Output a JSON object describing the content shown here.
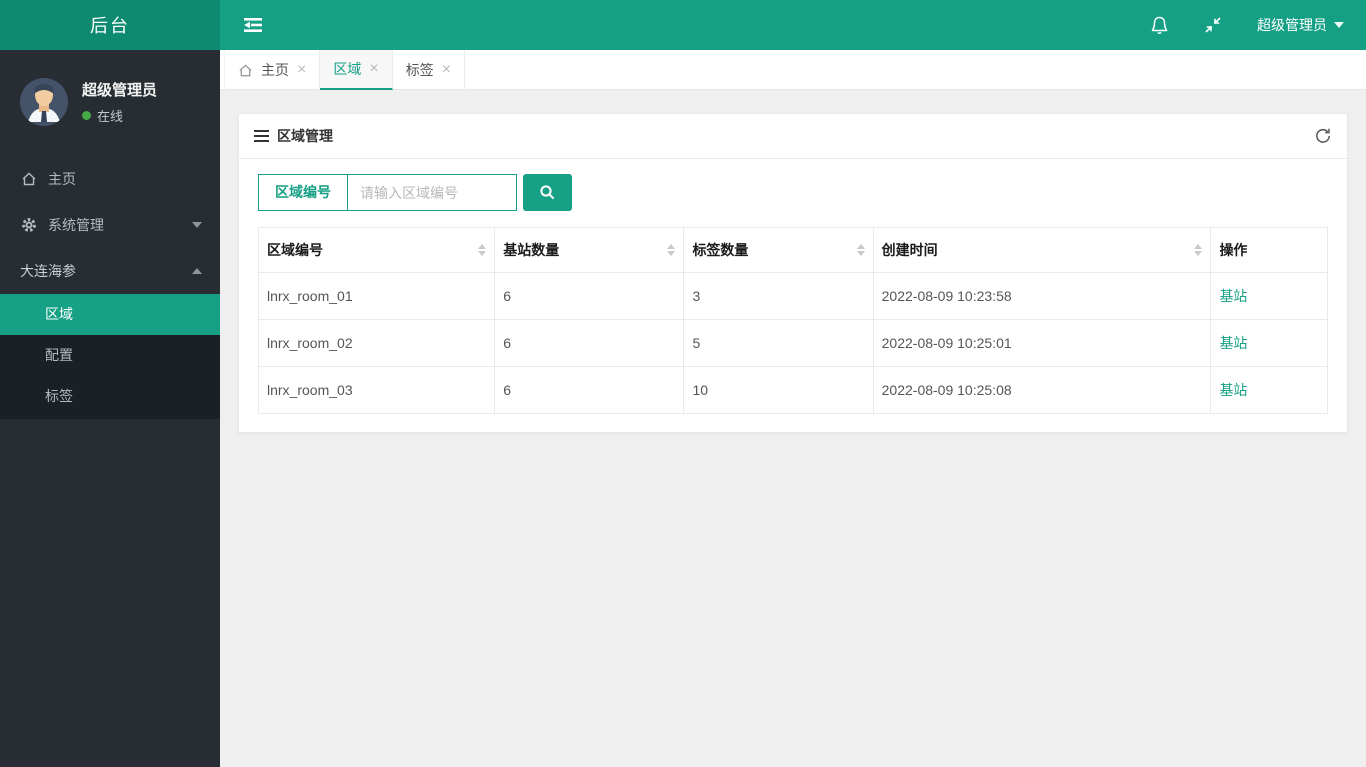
{
  "app": {
    "logo_text": "后台"
  },
  "header": {
    "user_name": "超级管理员"
  },
  "sidebar": {
    "user": {
      "name": "超级管理员",
      "status": "在线"
    },
    "menu": {
      "home": "主页",
      "system": "系统管理",
      "group": "大连海参",
      "sub": [
        "区域",
        "配置",
        "标签"
      ]
    }
  },
  "tabs": [
    {
      "label": "主页"
    },
    {
      "label": "区域"
    },
    {
      "label": "标签"
    }
  ],
  "icons": {
    "close": "×"
  },
  "panel": {
    "title": "区域管理",
    "search": {
      "label": "区域编号",
      "placeholder": "请输入区域编号"
    },
    "table": {
      "headers": [
        "区域编号",
        "基站数量",
        "标签数量",
        "创建时间",
        "操作"
      ],
      "rows": [
        {
          "id": "lnrx_room_01",
          "stations": "6",
          "tags": "3",
          "created": "2022-08-09 10:23:58",
          "action": "基站"
        },
        {
          "id": "lnrx_room_02",
          "stations": "6",
          "tags": "5",
          "created": "2022-08-09 10:25:01",
          "action": "基站"
        },
        {
          "id": "lnrx_room_03",
          "stations": "6",
          "tags": "10",
          "created": "2022-08-09 10:25:08",
          "action": "基站"
        }
      ]
    }
  },
  "colors": {
    "accent": "#16a085",
    "header_bg": "#15a086",
    "logo_bg": "#0d8a70",
    "sidebar_bg": "#282d33",
    "submenu_bg": "#1b2025",
    "content_bg": "#efefef",
    "border": "#e7eaec",
    "online_dot": "#45a945"
  }
}
